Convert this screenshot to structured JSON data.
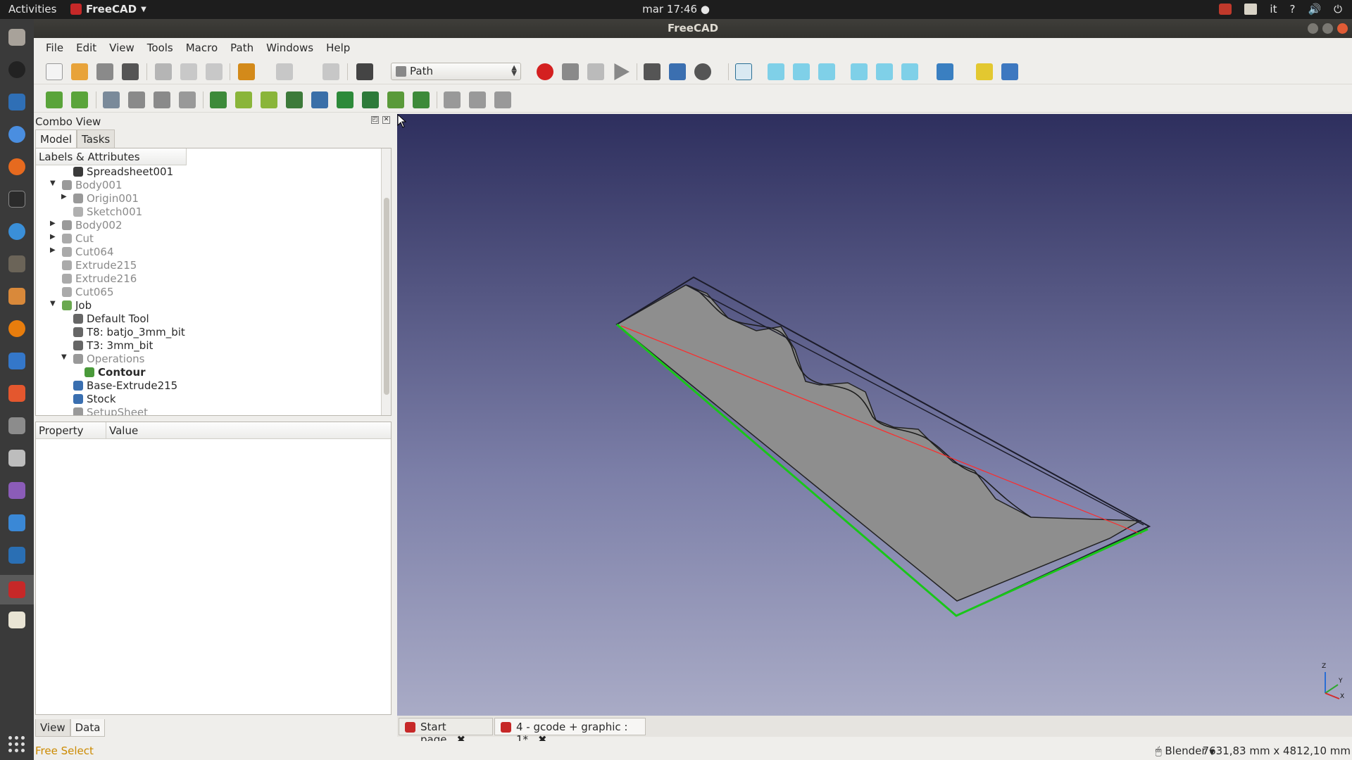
{
  "topbar": {
    "activities": "Activities",
    "app_name": "FreeCAD",
    "clock": "mar 17:46",
    "lang": "it",
    "help": "?"
  },
  "window": {
    "title": "FreeCAD"
  },
  "menubar": [
    "File",
    "Edit",
    "View",
    "Tools",
    "Macro",
    "Path",
    "Windows",
    "Help"
  ],
  "toolbar": {
    "workbench": "Path"
  },
  "combo": {
    "title": "Combo View",
    "tabs": [
      "Model",
      "Tasks"
    ],
    "tree_header": "Labels & Attributes",
    "tree": [
      {
        "label": "Spreadsheet001",
        "icon": "spreadsheet-icon",
        "expander": ""
      },
      {
        "label": "Body001",
        "icon": "body-icon",
        "expander": "▼"
      },
      {
        "label": "Origin001",
        "icon": "origin-icon",
        "expander": "▶"
      },
      {
        "label": "Sketch001",
        "icon": "sketch-icon",
        "expander": ""
      },
      {
        "label": "Body002",
        "icon": "body-icon",
        "expander": "▶"
      },
      {
        "label": "Cut",
        "icon": "cut-icon",
        "expander": "▶"
      },
      {
        "label": "Cut064",
        "icon": "cut-icon",
        "expander": "▶"
      },
      {
        "label": "Extrude215",
        "icon": "extrude-icon",
        "expander": ""
      },
      {
        "label": "Extrude216",
        "icon": "extrude-icon",
        "expander": ""
      },
      {
        "label": "Cut065",
        "icon": "cut-icon",
        "expander": ""
      },
      {
        "label": "Job",
        "icon": "job-icon",
        "expander": "▼"
      },
      {
        "label": "Default Tool",
        "icon": "tool-icon",
        "expander": ""
      },
      {
        "label": "T8: batjo_3mm_bit",
        "icon": "tool-icon",
        "expander": ""
      },
      {
        "label": "T3: 3mm_bit",
        "icon": "tool-icon",
        "expander": ""
      },
      {
        "label": "Operations",
        "icon": "operations-icon",
        "expander": "▼"
      },
      {
        "label": "Contour",
        "icon": "contour-icon",
        "expander": ""
      },
      {
        "label": "Base-Extrude215",
        "icon": "base-icon",
        "expander": ""
      },
      {
        "label": "Stock",
        "icon": "stock-icon",
        "expander": ""
      },
      {
        "label": "SetupSheet",
        "icon": "setupsheet-icon",
        "expander": ""
      }
    ],
    "property_header": "Property",
    "value_header": "Value",
    "bottom_tabs": [
      "View",
      "Data"
    ]
  },
  "doc_tabs": [
    {
      "label": "Start page"
    },
    {
      "label": "4 - gcode + graphic : 1*"
    }
  ],
  "axis": {
    "z": "Z",
    "y": "Y",
    "x": "X"
  },
  "status": {
    "message": "Free Select",
    "nav_style": "Blender",
    "dimensions": "7631,83 mm x 4812,10 mm"
  },
  "colors": {
    "status_message": "#cc8a00",
    "toolpath": "#ff2a2a",
    "edge_highlight": "#19c619",
    "part_face": "#8e8e8e"
  }
}
